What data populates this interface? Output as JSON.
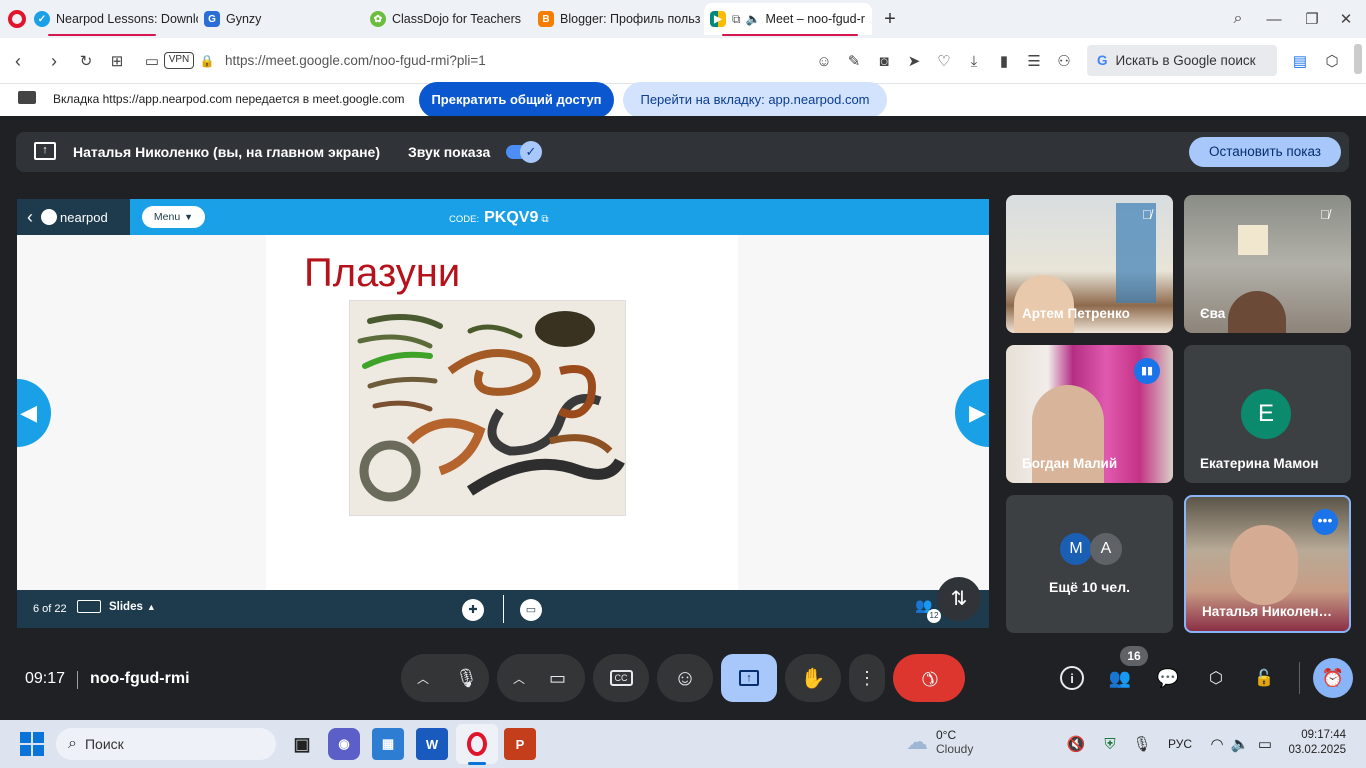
{
  "browser": {
    "tabs": [
      {
        "title": "Nearpod Lessons: Downlo",
        "icon": "nearpod-icon",
        "color": "#1aa0e6"
      },
      {
        "title": "Gynzy",
        "icon": "gynzy-icon",
        "color": "#2b6fd6"
      },
      {
        "title": "ClassDojo for Teachers",
        "icon": "classdojo-icon",
        "color": "#6bbd3e"
      },
      {
        "title": "Blogger: Профиль пользо",
        "icon": "blogger-icon",
        "color": "#f57d00"
      },
      {
        "title": "Meet – noo-fgud-r",
        "icon": "meet-icon",
        "color": "#00897b"
      }
    ],
    "url": "https://meet.google.com/noo-fgud-rmi?pli=1",
    "vpn_label": "VPN",
    "search_placeholder": "Искать в Google поиск"
  },
  "share_banner": {
    "message": "Вкладка https://app.nearpod.com передается в meet.google.com",
    "stop_button": "Прекратить общий доступ",
    "goto_button": "Перейти на вкладку: app.nearpod.com"
  },
  "presenting_bar": {
    "presenter": "Наталья Николенко (вы, на главном экране)",
    "audio_label": "Звук показа",
    "audio_on": true,
    "stop_button": "Остановить показ"
  },
  "nearpod": {
    "logo": "nearpod",
    "menu_label": "Menu",
    "code_label": "CODE:",
    "code": "PKQV9",
    "slide_title": "Плазуни",
    "page_indicator": "6 of 22",
    "slides_label": "Slides",
    "participants_count": "12",
    "accent_color": "#1aa0e6",
    "dark_color": "#1d3b4d"
  },
  "participants": [
    {
      "name": "Артем Петренко",
      "muted": true,
      "has_video": true
    },
    {
      "name": "Єва",
      "muted": true,
      "has_video": true
    },
    {
      "name": "Богдан Малий",
      "speaking": true,
      "has_video": true
    },
    {
      "name": "Екатерина Мамон",
      "initial": "E",
      "avatar_color": "#0b8a6e"
    },
    {
      "name": "Ещё 10 чел.",
      "initials": [
        "M",
        "A"
      ]
    },
    {
      "name": "Наталья Николен…",
      "has_video": true,
      "self": true
    }
  ],
  "meeting": {
    "time": "09:17",
    "code": "noo-fgud-rmi",
    "people_count": "16"
  },
  "taskbar": {
    "search_placeholder": "Поиск",
    "weather_temp": "0°C",
    "weather_desc": "Cloudy",
    "lang": "РУС",
    "time": "09:17:44",
    "date": "03.02.2025"
  }
}
